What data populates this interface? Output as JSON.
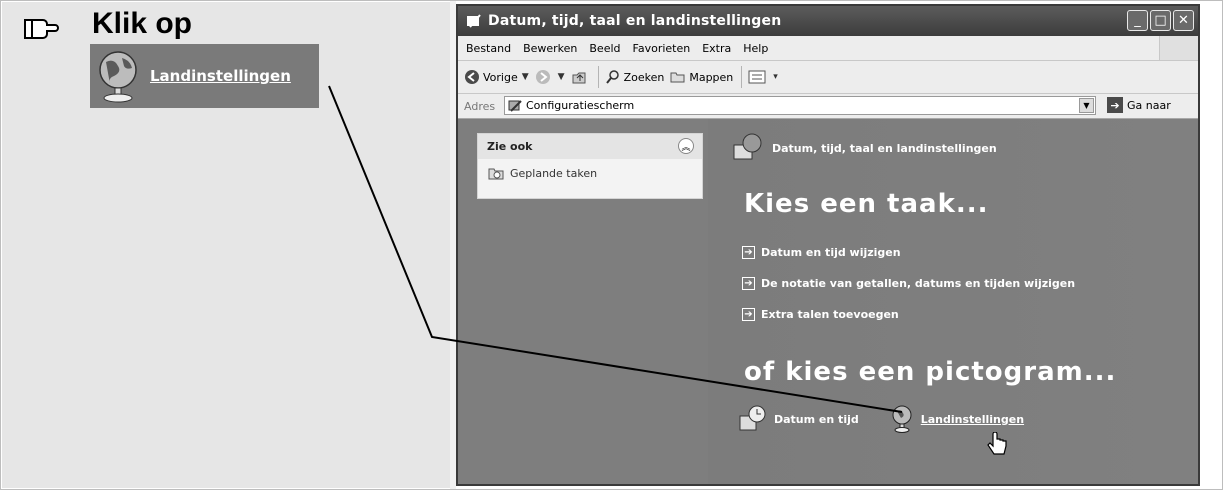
{
  "instruction": {
    "heading": "Klik op",
    "target_label": "Landinstellingen"
  },
  "window": {
    "title": "Datum, tijd, taal en landinstellingen",
    "menu": [
      "Bestand",
      "Bewerken",
      "Beeld",
      "Favorieten",
      "Extra",
      "Help"
    ],
    "toolbar": {
      "back_label": "Vorige",
      "search_label": "Zoeken",
      "folders_label": "Mappen"
    },
    "address": {
      "label": "Adres",
      "value": "Configuratiescherm",
      "go_label": "Ga naar"
    },
    "sidebar": {
      "section_title": "Zie ook",
      "items": [
        "Geplande taken"
      ]
    },
    "main": {
      "category_title": "Datum, tijd, taal en landinstellingen",
      "pick_task_heading": "Kies een taak...",
      "tasks": [
        "Datum en tijd wijzigen",
        "De notatie van getallen, datums en tijden wijzigen",
        "Extra talen toevoegen"
      ],
      "pick_icon_heading": "of kies een pictogram...",
      "icons": [
        "Datum en tijd",
        "Landinstellingen"
      ]
    }
  },
  "colors": {
    "window_frame": "#4a4a4a",
    "content_bg": "#7e7e7e",
    "callout_bg": "#7a7a7a"
  }
}
